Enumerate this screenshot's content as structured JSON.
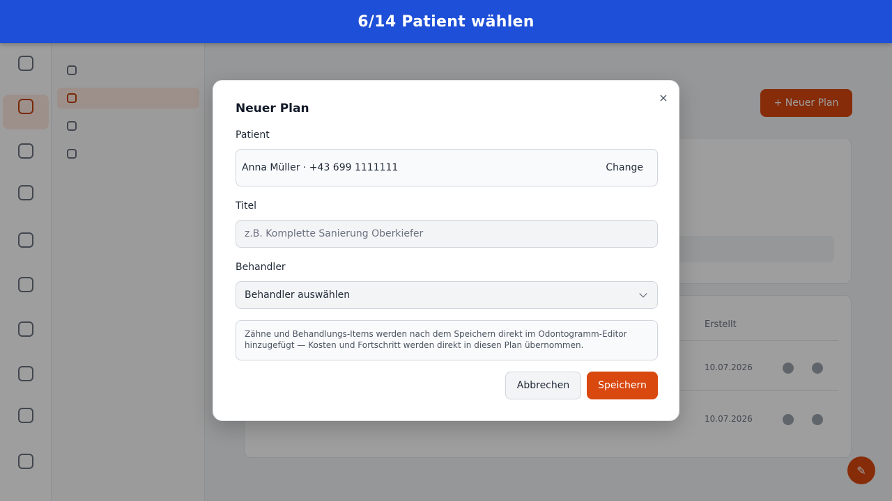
{
  "header": {
    "title": "6/14 Patient wählen"
  },
  "modal": {
    "title": "Neuer Plan",
    "patient_label": "Patient",
    "patient_value": "Anna Müller · +43 699 1111111",
    "change_label": "Change",
    "title_label": "Titel",
    "title_placeholder": "z.B. Komplette Sanierung Oberkiefer",
    "provider_label": "Behandler",
    "provider_selected": "Behandler auswählen",
    "info_text": "Zähne und Behandlungs-Items werden nach dem Speichern direkt im Odontogramm-Editor hinzugefügt — Kosten und Fortschritt werden direkt in diesen Plan übernommen.",
    "cancel_label": "Abbrechen",
    "save_label": "Speichern",
    "close_glyph": "×"
  },
  "background": {
    "new_plan_label": "+ Neuer Plan",
    "created_header": "Erstellt",
    "dates": [
      "10.07.2026",
      "10.07.2026"
    ],
    "fab_glyph": "✎"
  },
  "colors": {
    "brand_header": "#1e4fd8",
    "accent": "#d9480f"
  },
  "icons": [
    "close-icon",
    "chevron-down-icon",
    "edit-icon"
  ]
}
